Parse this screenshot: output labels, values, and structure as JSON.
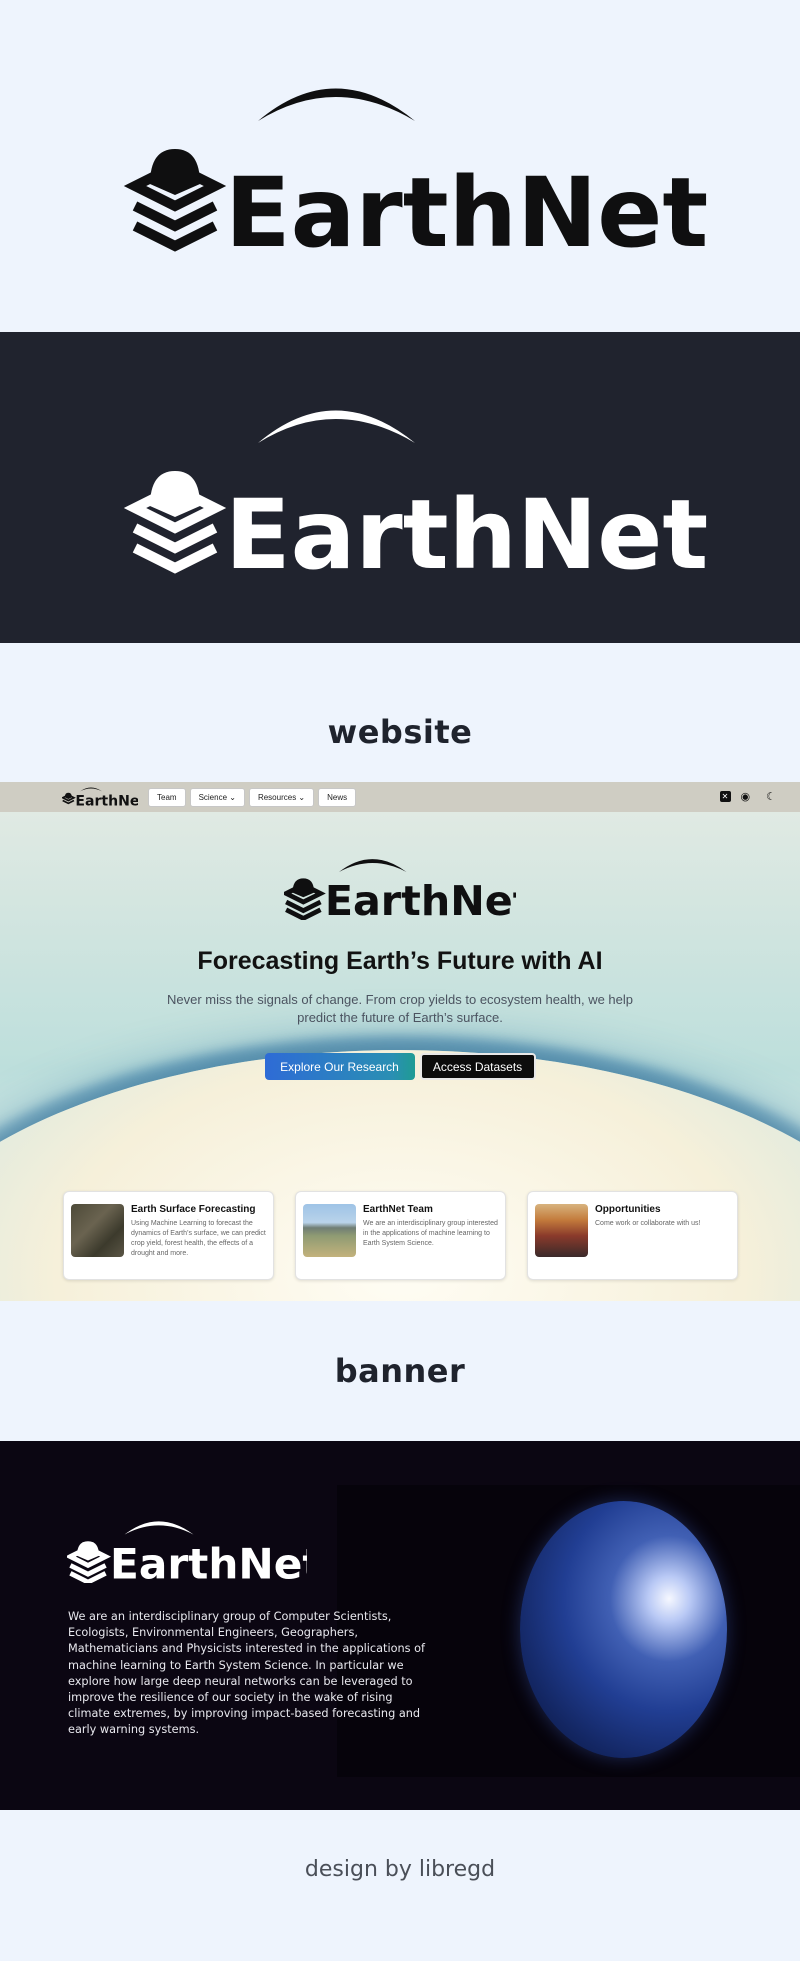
{
  "brand": {
    "name_left": "Earth",
    "name_right": "Net",
    "colors": {
      "light_bg": "#eef4fd",
      "dark_bg": "#20232e",
      "logo_dark": "#0f0f10",
      "logo_light": "#ffffff"
    }
  },
  "sections": {
    "website_label": "website",
    "banner_label": "banner",
    "credit": "design by libregd"
  },
  "site": {
    "nav": {
      "items": [
        {
          "label": "Team"
        },
        {
          "label": "Science ⌄"
        },
        {
          "label": "Resources ⌄"
        },
        {
          "label": "News"
        }
      ],
      "icons": [
        "x-icon",
        "github-icon",
        "moon-icon"
      ]
    },
    "hero": {
      "title": "Forecasting Earth’s Future with AI",
      "subtitle": "Never miss the signals of change. From crop yields to ecosystem health, we help predict the future of Earth’s surface.",
      "primary_cta": "Explore Our Research",
      "secondary_cta": "Access Datasets"
    },
    "cards": [
      {
        "title": "Earth Surface Forecasting",
        "desc": "Using Machine Learning to forecast the dynamics of Earth’s surface, we can predict crop yield, forest health, the effects of a drought and more."
      },
      {
        "title": "EarthNet Team",
        "desc": "We are an interdisciplinary group interested in the applications of machine learning to Earth System Science."
      },
      {
        "title": "Opportunities",
        "desc": "Come work or collaborate with us!"
      }
    ]
  },
  "banner": {
    "text": "We are an interdisciplinary group of Computer Scientists, Ecologists, Environmental Engineers, Geographers, Mathematicians and Physicists interested in the applications of machine learning to Earth System Science. In particular we explore how large deep neural networks can be leveraged to improve the resilience of our society in the wake of rising climate extremes, by improving impact-based forecasting and early warning systems."
  }
}
